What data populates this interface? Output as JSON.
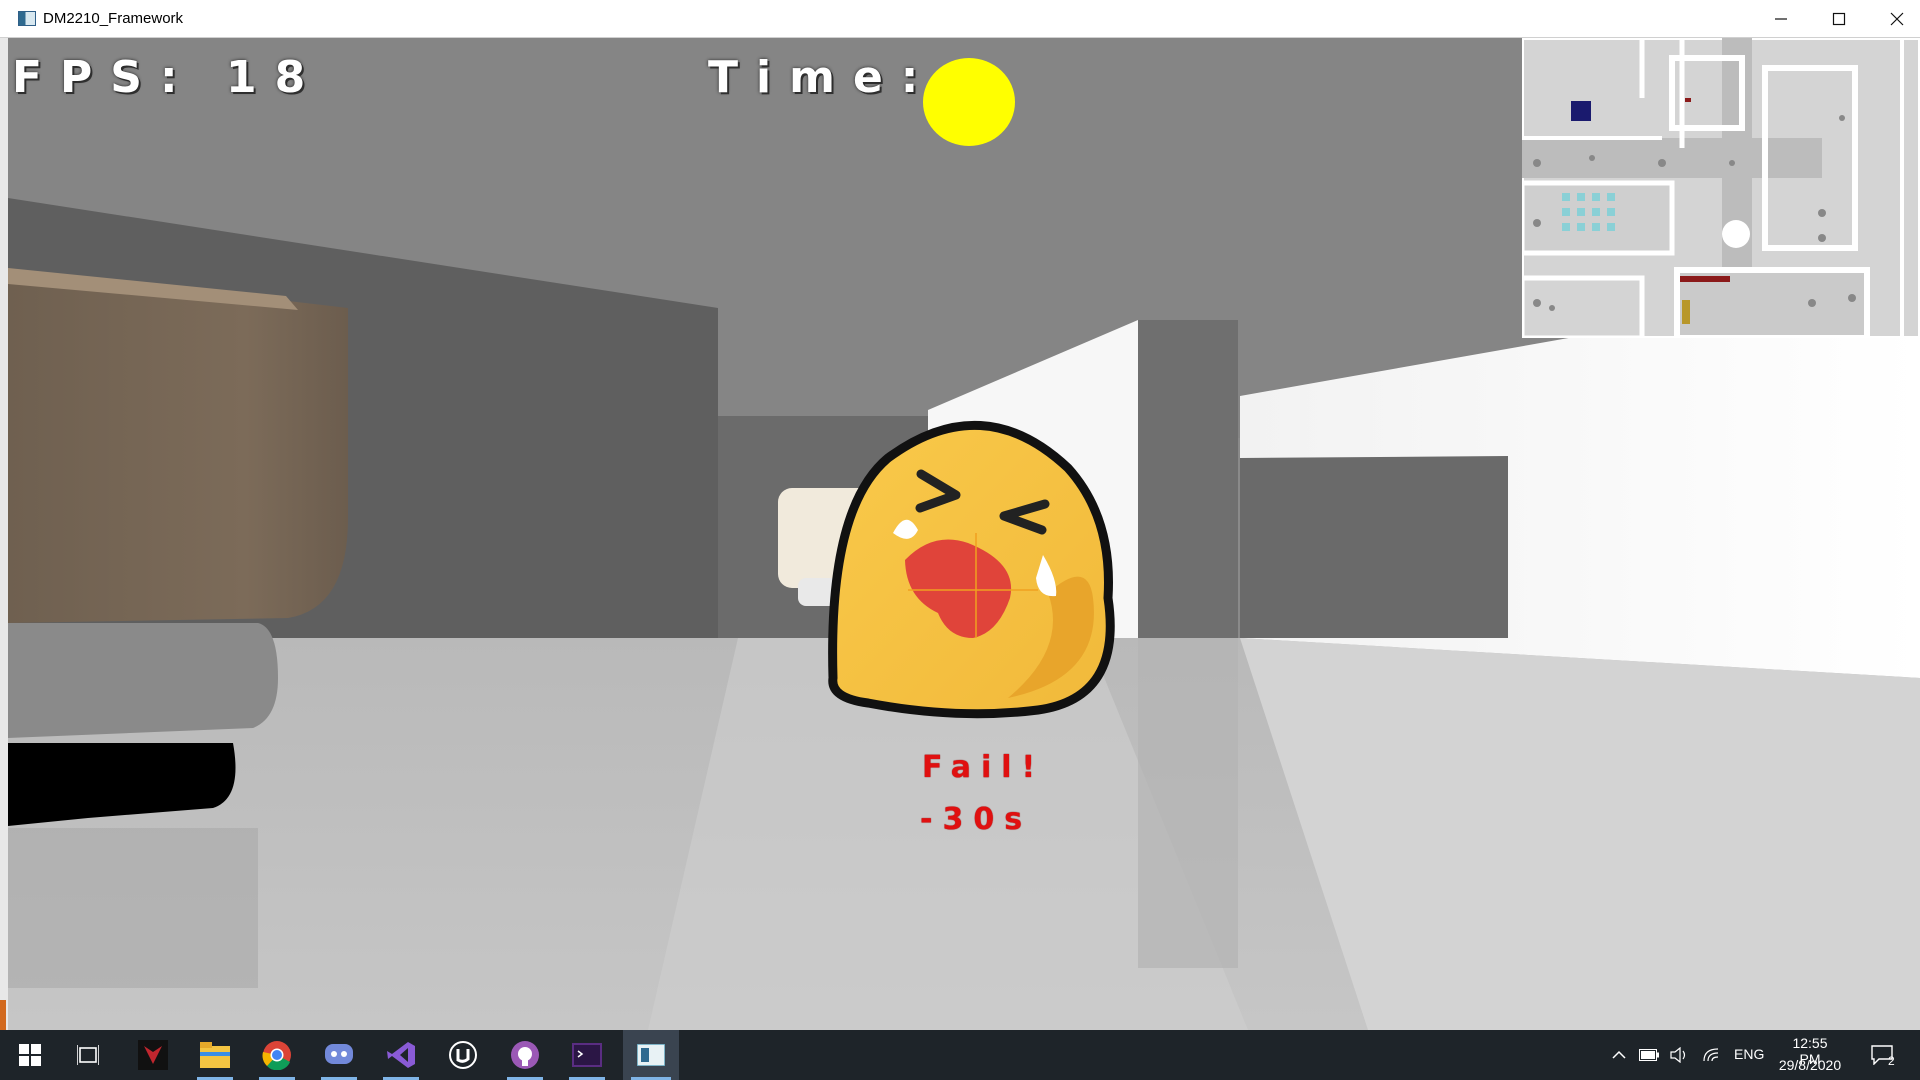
{
  "window": {
    "title": "DM2210_Framework",
    "minimize_icon": "minimize-icon",
    "maximize_icon": "maximize-icon",
    "close_icon": "close-icon"
  },
  "hud": {
    "fps_label": "FPS:",
    "fps_value": "18",
    "time_label": "Time:",
    "timer_color": "#ffff00"
  },
  "feedback": {
    "emoji": "crying-face-emoji",
    "fail_text": "Fail!",
    "penalty_text": "-30s",
    "text_color": "#e01010"
  },
  "minimap": {
    "name": "level-minimap"
  },
  "taskbar": {
    "apps": [
      {
        "name": "start-icon"
      },
      {
        "name": "task-view-icon"
      },
      {
        "name": "predator-sense-icon"
      },
      {
        "name": "file-explorer-icon"
      },
      {
        "name": "chrome-icon"
      },
      {
        "name": "discord-icon"
      },
      {
        "name": "visual-studio-icon"
      },
      {
        "name": "unreal-engine-icon"
      },
      {
        "name": "github-desktop-icon"
      },
      {
        "name": "terminal-icon"
      },
      {
        "name": "dm2210-framework-icon"
      }
    ],
    "language": "ENG",
    "time": "12:55 PM",
    "date": "29/8/2020",
    "notification_count": "2"
  }
}
